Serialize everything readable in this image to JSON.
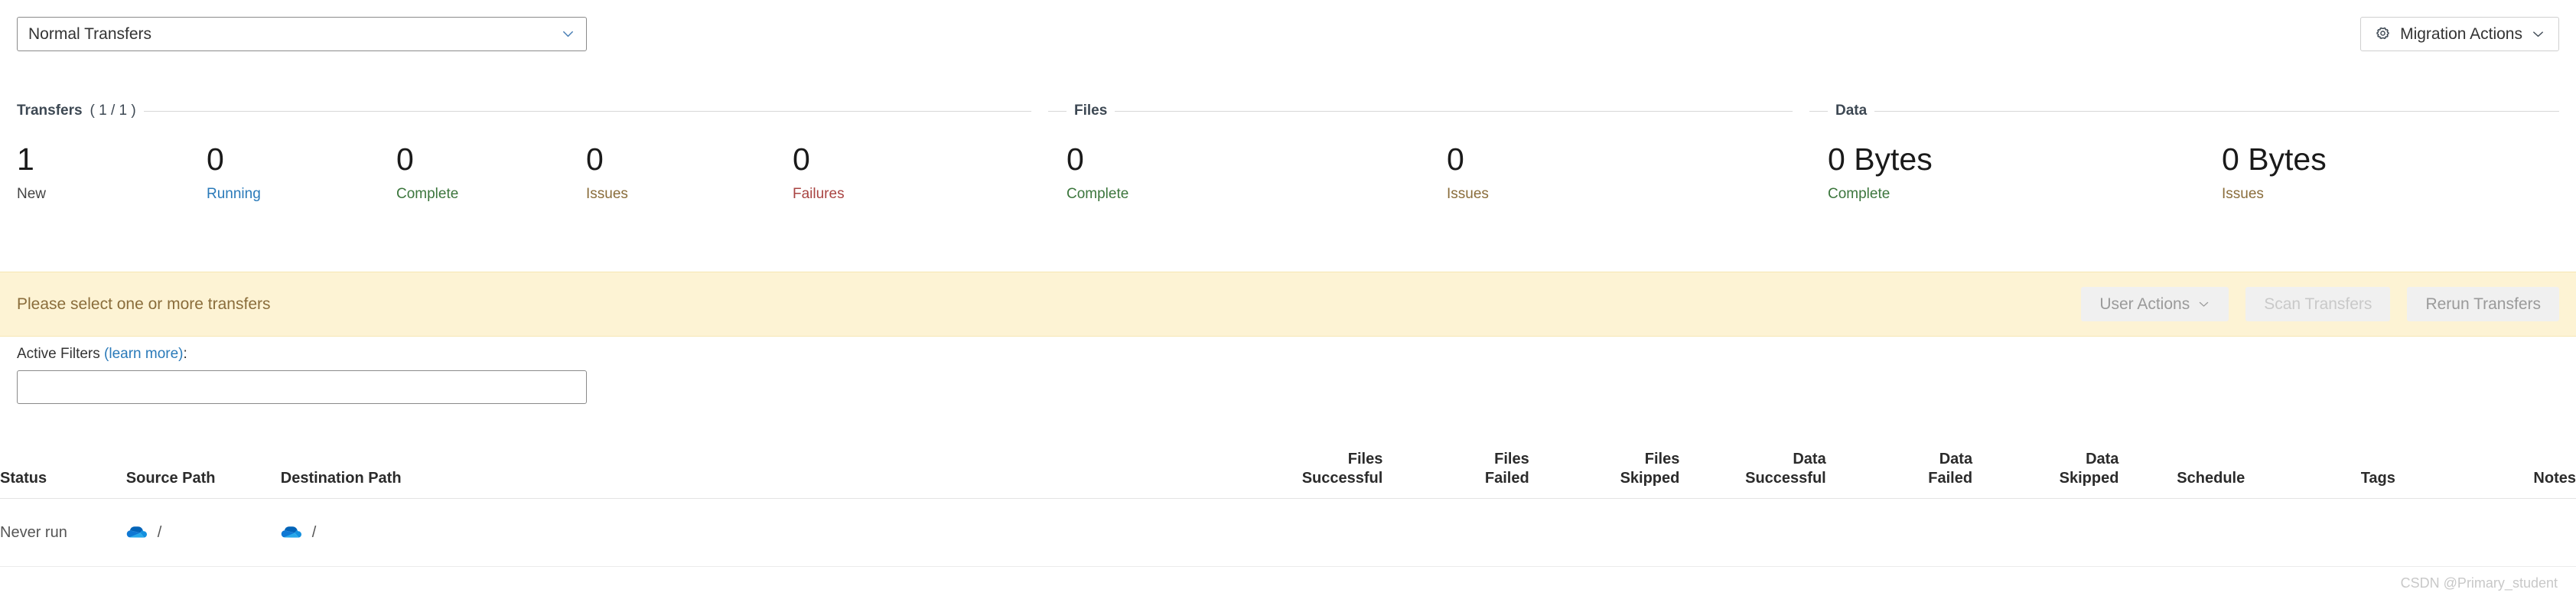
{
  "toolbar": {
    "transfer_type_select": {
      "value": "Normal Transfers",
      "chevron_icon": "chevron-down-icon"
    },
    "migration_actions": {
      "label": "Migration Actions",
      "gear_icon": "gear-icon",
      "chevron_icon": "chevron-down-icon"
    }
  },
  "summary": {
    "groups": [
      {
        "title": "Transfers",
        "count": "( 1 / 1 )",
        "stats": [
          {
            "value": "1",
            "label": "New",
            "color": "#444444"
          },
          {
            "value": "0",
            "label": "Running",
            "color": "#2a7ab9"
          },
          {
            "value": "0",
            "label": "Complete",
            "color": "#3c763d"
          },
          {
            "value": "0",
            "label": "Issues",
            "color": "#8a6d3b"
          },
          {
            "value": "0",
            "label": "Failures",
            "color": "#a94442"
          }
        ]
      },
      {
        "title": "Files",
        "count": "",
        "stats": [
          {
            "value": "0",
            "label": "Complete",
            "color": "#3c763d"
          },
          {
            "value": "0",
            "label": "Issues",
            "color": "#8a6d3b"
          }
        ]
      },
      {
        "title": "Data",
        "count": "",
        "stats": [
          {
            "value": "0 Bytes",
            "label": "Complete",
            "color": "#3c763d"
          },
          {
            "value": "0 Bytes",
            "label": "Issues",
            "color": "#8a6d3b"
          }
        ]
      }
    ]
  },
  "alert": {
    "message": "Please select one or more transfers",
    "background": "#fdf3d4",
    "text_color": "#8a6d3b",
    "buttons": [
      {
        "label": "User Actions",
        "has_chevron": true,
        "state": "disabled"
      },
      {
        "label": "Scan Transfers",
        "has_chevron": false,
        "state": "disabled-dim"
      },
      {
        "label": "Rerun Transfers",
        "has_chevron": false,
        "state": "disabled"
      }
    ]
  },
  "filters": {
    "label_prefix": "Active Filters ",
    "link_text": "(learn more)",
    "label_suffix": ":",
    "value": "",
    "placeholder": ""
  },
  "table": {
    "columns": [
      {
        "key": "status",
        "line1": "Status",
        "line2": "",
        "align": "left"
      },
      {
        "key": "source_path",
        "line1": "Source Path",
        "line2": "",
        "align": "left"
      },
      {
        "key": "destination_path",
        "line1": "Destination Path",
        "line2": "",
        "align": "left"
      },
      {
        "key": "files_successful",
        "line1": "Files",
        "line2": "Successful",
        "align": "right"
      },
      {
        "key": "files_failed",
        "line1": "Files",
        "line2": "Failed",
        "align": "right"
      },
      {
        "key": "files_skipped",
        "line1": "Files",
        "line2": "Skipped",
        "align": "right"
      },
      {
        "key": "data_successful",
        "line1": "Data",
        "line2": "Successful",
        "align": "right"
      },
      {
        "key": "data_failed",
        "line1": "Data",
        "line2": "Failed",
        "align": "right"
      },
      {
        "key": "data_skipped",
        "line1": "Data",
        "line2": "Skipped",
        "align": "right"
      },
      {
        "key": "schedule",
        "line1": "Schedule",
        "line2": "",
        "align": "right"
      },
      {
        "key": "tags",
        "line1": "Tags",
        "line2": "",
        "align": "right"
      },
      {
        "key": "notes",
        "line1": "Notes",
        "line2": "",
        "align": "right"
      }
    ],
    "rows": [
      {
        "status": "Never run",
        "source_icon": "onedrive-cloud-icon",
        "source_path": "/",
        "destination_icon": "onedrive-cloud-icon",
        "destination_path": "/",
        "files_successful": "",
        "files_failed": "",
        "files_skipped": "",
        "data_successful": "",
        "data_failed": "",
        "data_skipped": "",
        "schedule": "",
        "tags": "",
        "notes": ""
      }
    ]
  },
  "watermark": "CSDN @Primary_student"
}
